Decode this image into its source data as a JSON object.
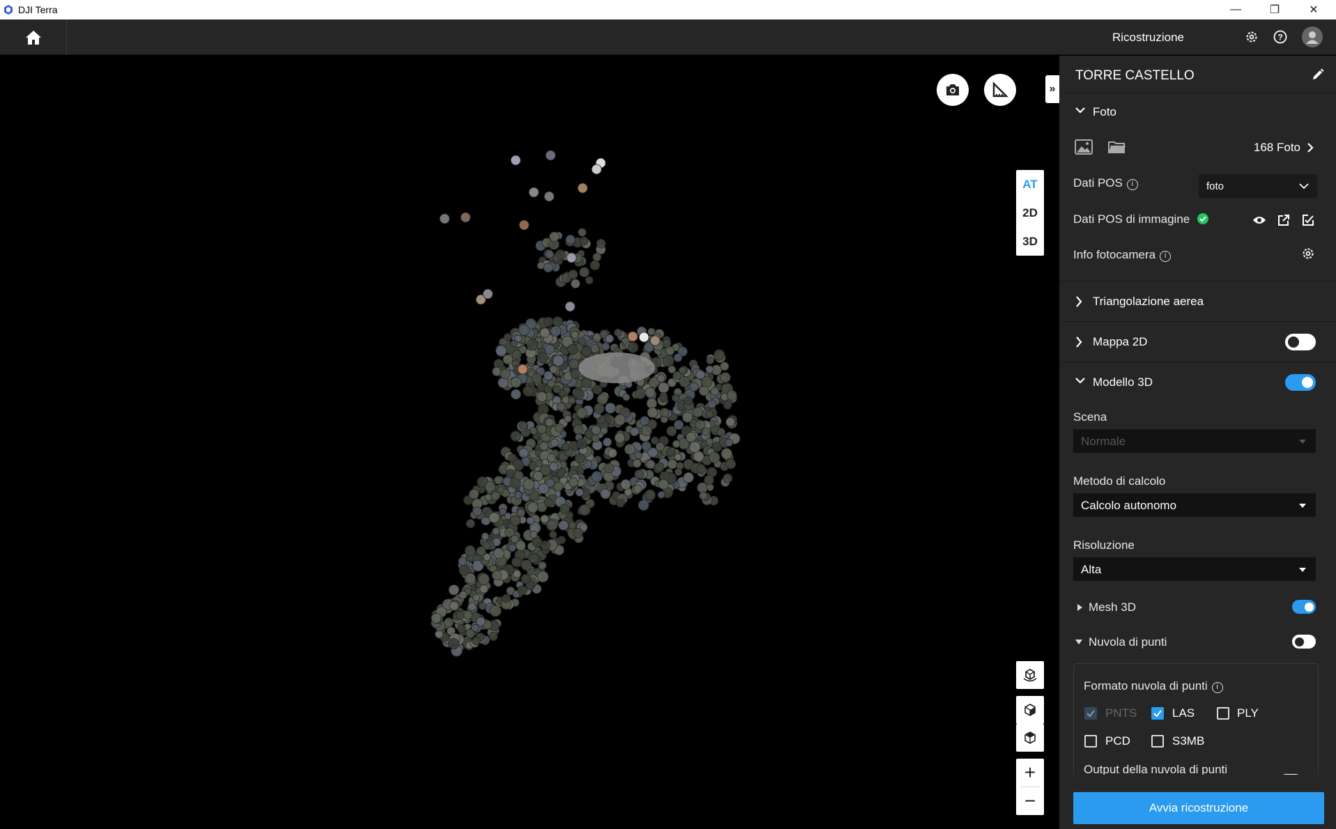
{
  "app": {
    "title": "DJI Terra"
  },
  "topbar": {
    "title": "Ricostruzione"
  },
  "view_modes": [
    "AT",
    "2D",
    "3D"
  ],
  "panel": {
    "project_name": "TORRE CASTELLO",
    "foto": {
      "header": "Foto",
      "count": "168 Foto",
      "pos_label": "Dati POS",
      "pos_value": "foto",
      "pos_image_label": "Dati POS di immagine",
      "camera_label": "Info fotocamera"
    },
    "triangulation": {
      "header": "Triangolazione aerea"
    },
    "map2d": {
      "header": "Mappa 2D",
      "enabled": false
    },
    "model3d": {
      "header": "Modello 3D",
      "enabled": true,
      "scene_label": "Scena",
      "scene_value": "Normale",
      "method_label": "Metodo di calcolo",
      "method_value": "Calcolo autonomo",
      "resolution_label": "Risoluzione",
      "resolution_value": "Alta",
      "mesh_label": "Mesh 3D",
      "mesh_enabled": true,
      "pointcloud_label": "Nuvola di punti",
      "pointcloud_enabled": false,
      "format_label": "Formato nuvola di punti",
      "formats": [
        {
          "label": "PNTS",
          "checked": true,
          "disabled": true
        },
        {
          "label": "LAS",
          "checked": true,
          "disabled": false
        },
        {
          "label": "PLY",
          "checked": false,
          "disabled": false
        },
        {
          "label": "PCD",
          "checked": false,
          "disabled": false
        },
        {
          "label": "S3MB",
          "checked": false,
          "disabled": false
        }
      ],
      "output_label": "Output della nuvola di punti"
    },
    "start_button": "Avvia ricostruzione"
  },
  "colors": {
    "accent": "#2b9bf0",
    "panel_bg": "#262626",
    "topbar_bg": "#262626"
  }
}
